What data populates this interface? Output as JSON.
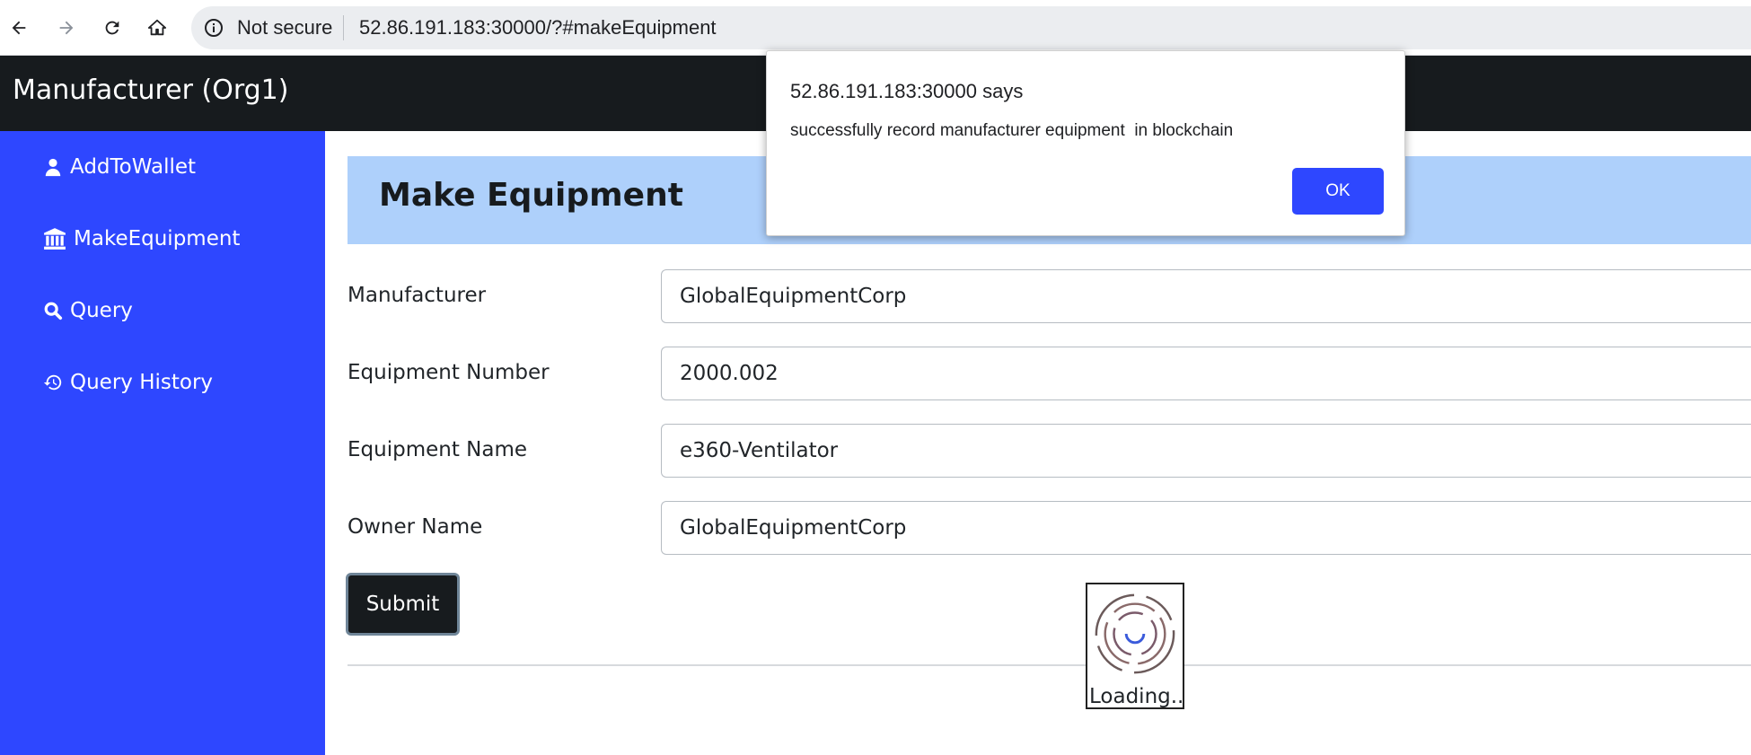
{
  "browser": {
    "back_icon": "arrow-left-icon",
    "forward_icon": "arrow-right-icon",
    "reload_icon": "reload-icon",
    "home_icon": "home-icon",
    "security_label": "Not secure",
    "url": "52.86.191.183:30000/?#makeEquipment"
  },
  "header": {
    "title": "Manufacturer (Org1)"
  },
  "sidebar": {
    "items": [
      {
        "label": "AddToWallet",
        "icon": "user-icon"
      },
      {
        "label": "MakeEquipment",
        "icon": "bank-icon"
      },
      {
        "label": "Query",
        "icon": "search-icon"
      },
      {
        "label": "Query History",
        "icon": "history-icon"
      }
    ]
  },
  "main": {
    "title": "Make Equipment",
    "fields": [
      {
        "label": "Manufacturer",
        "value": "GlobalEquipmentCorp"
      },
      {
        "label": "Equipment Number",
        "value": "2000.002"
      },
      {
        "label": "Equipment Name",
        "value": "e360-Ventilator"
      },
      {
        "label": "Owner Name",
        "value": "GlobalEquipmentCorp"
      }
    ],
    "submit_label": "Submit",
    "loading_text": "Loading.."
  },
  "alert": {
    "title": "52.86.191.183:30000 says",
    "message": "successfully record manufacturer equipment  in blockchain",
    "ok_label": "OK"
  },
  "colors": {
    "sidebar": "#2e47ff",
    "header": "#171b1e",
    "banner": "#aed0fb",
    "ok_button": "#2e47ff"
  }
}
